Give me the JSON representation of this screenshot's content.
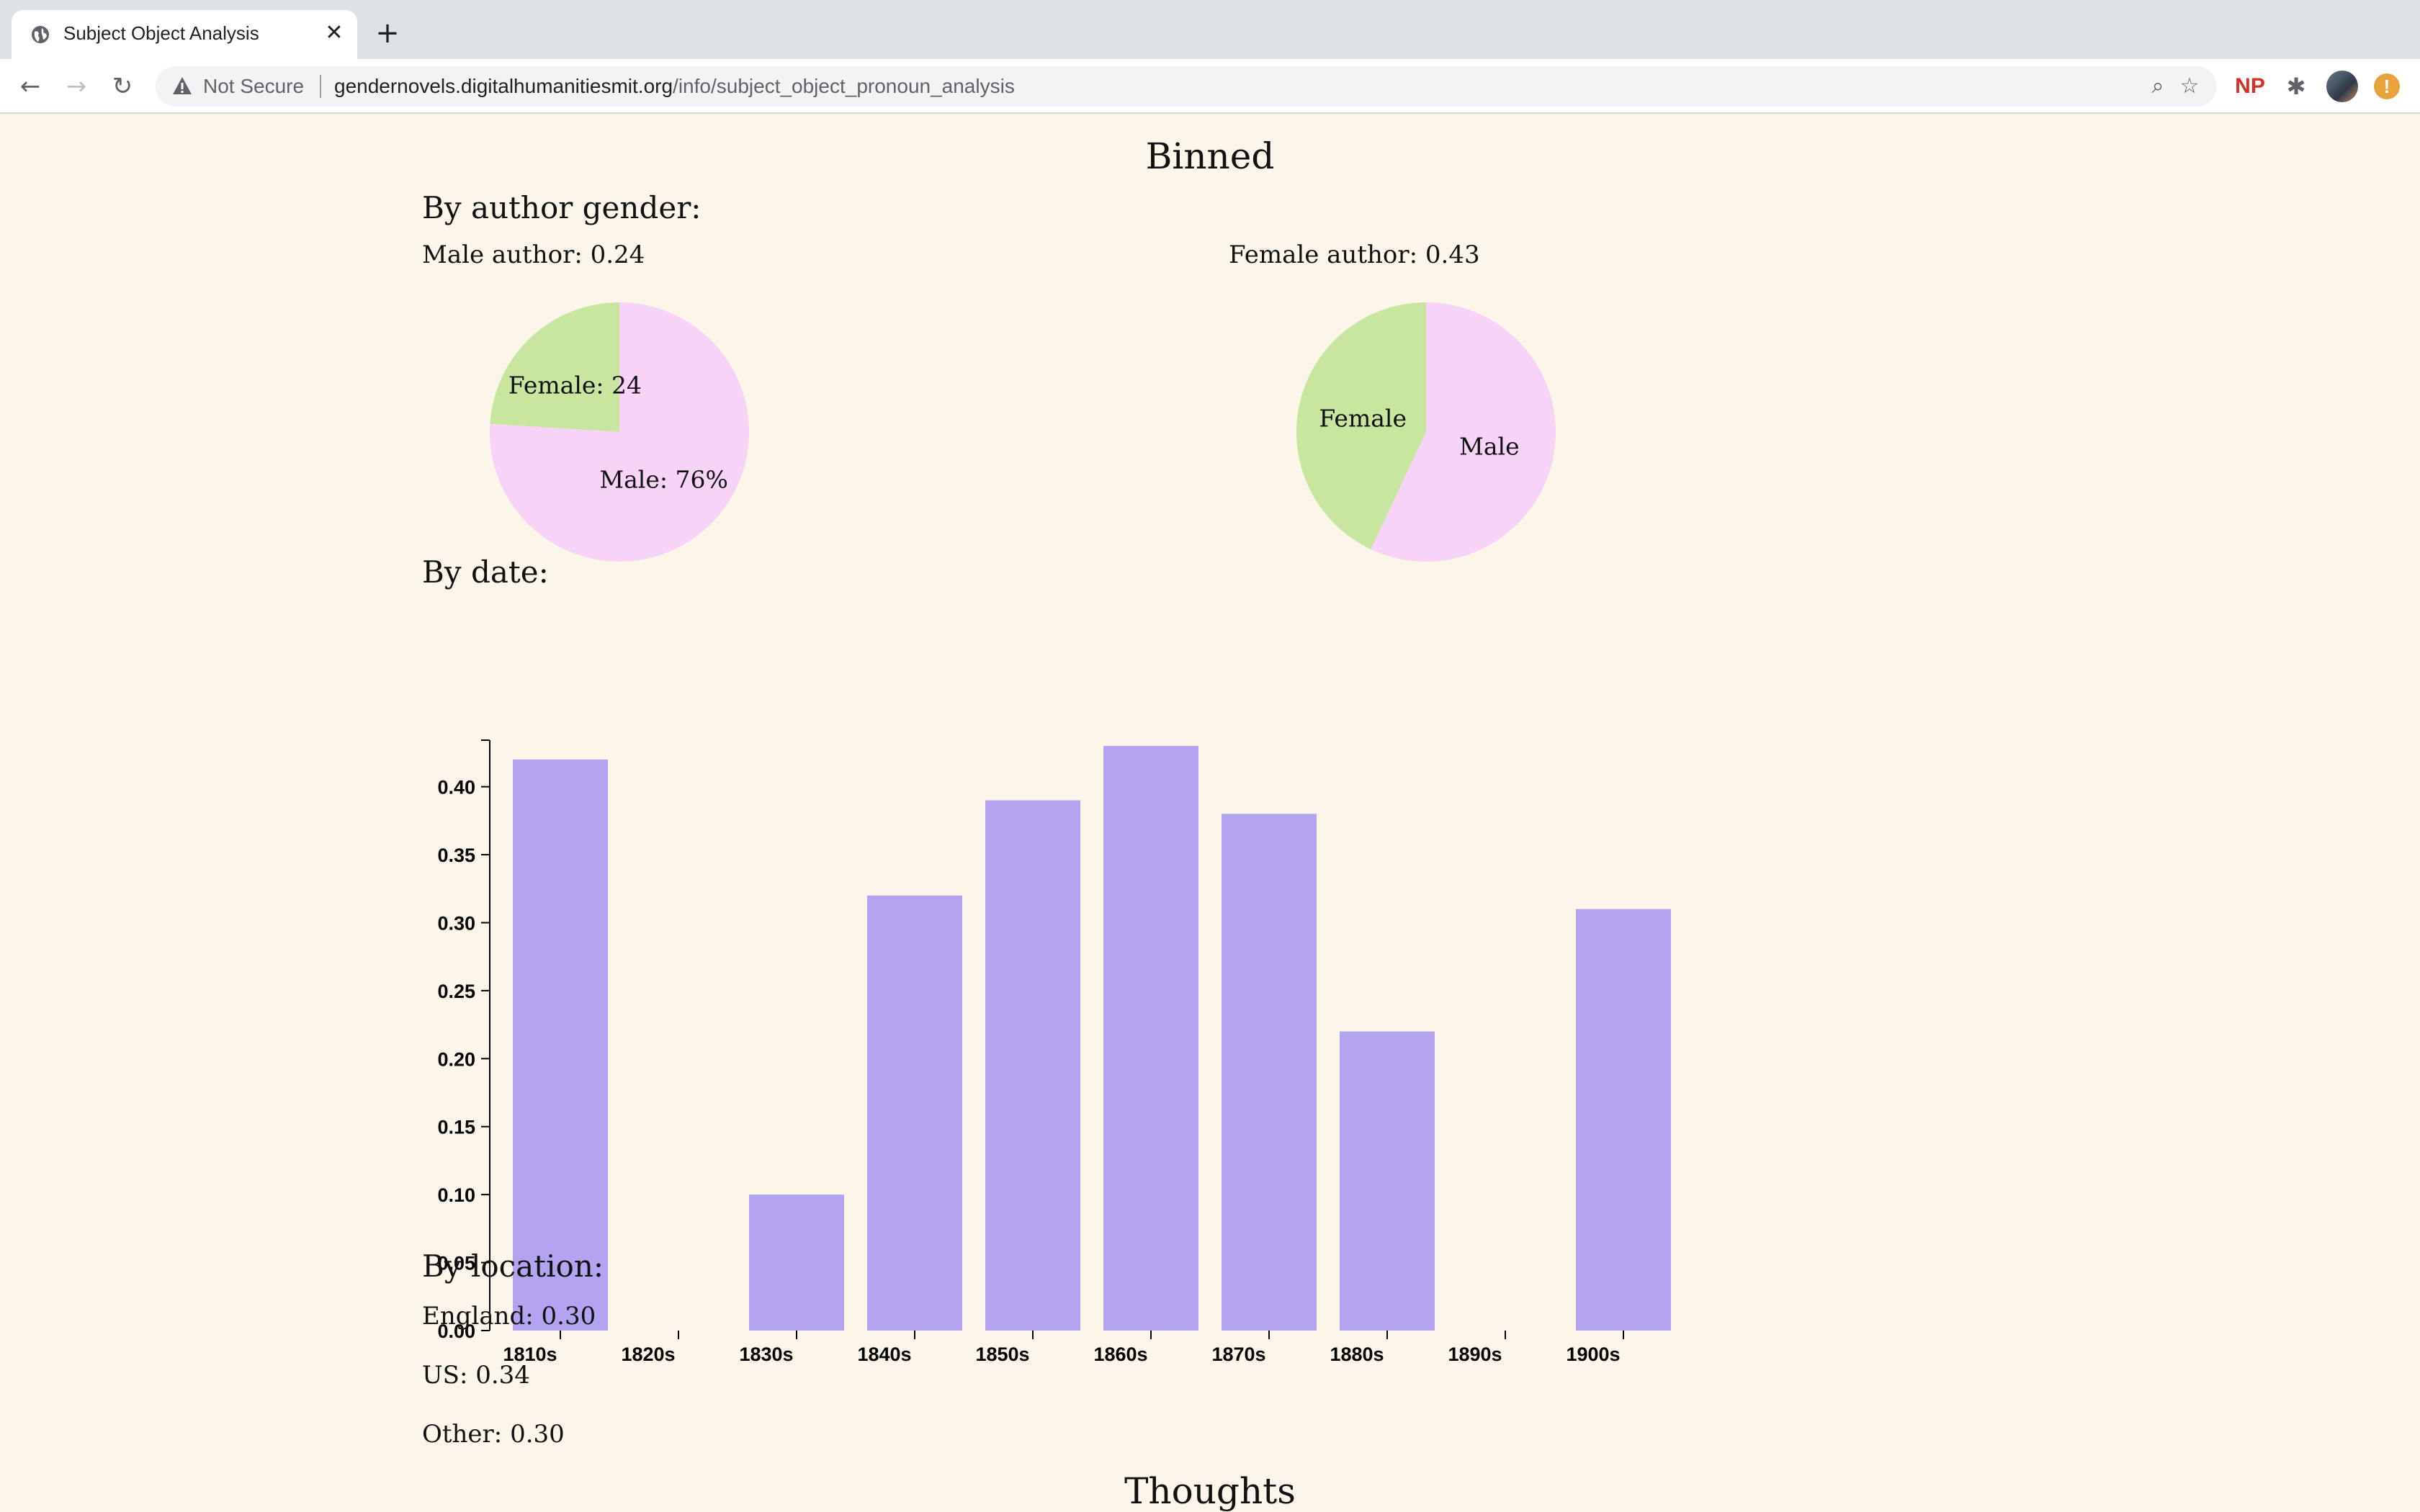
{
  "browser": {
    "tab_title": "Subject Object Analysis",
    "tab_close_glyph": "✕",
    "new_tab_glyph": "+",
    "security_label": "Not Secure",
    "url_host": "gendernovels.digitalhumanitiesmit.org",
    "url_path": "/info/subject_object_pronoun_analysis",
    "extension_np": "NP",
    "update_badge": "!"
  },
  "page": {
    "binned_heading": "Binned",
    "by_author_gender_heading": "By author gender:",
    "male_author_label": "Male author: 0.24",
    "female_author_label": "Female author: 0.43",
    "by_date_heading": "By date:",
    "by_location_heading": "By location:",
    "locations": [
      "England: 0.30",
      "US: 0.34",
      "Other: 0.30"
    ],
    "thoughts_heading": "Thoughts"
  },
  "colors": {
    "female_slice": "#c8e6a0",
    "male_slice": "#f7d4f7",
    "bar": "#b3a3f0",
    "page_bg": "#fbf5ea"
  },
  "chart_data": [
    {
      "type": "pie",
      "title": "Male author: 0.24",
      "slices": [
        {
          "label": "Female: 24",
          "value": 24
        },
        {
          "label": "Male: 76%",
          "value": 76
        }
      ]
    },
    {
      "type": "pie",
      "title": "Female author: 0.43",
      "slices": [
        {
          "label": "Female",
          "value": 43
        },
        {
          "label": "Male",
          "value": 57
        }
      ]
    },
    {
      "type": "bar",
      "title": "By date:",
      "categories": [
        "1810s",
        "1820s",
        "1830s",
        "1840s",
        "1850s",
        "1860s",
        "1870s",
        "1880s",
        "1890s",
        "1900s"
      ],
      "values": [
        0.42,
        null,
        0.1,
        0.32,
        0.39,
        0.43,
        0.38,
        0.22,
        null,
        0.31
      ],
      "yticks": [
        "0.00",
        "0.05",
        "0.10",
        "0.15",
        "0.20",
        "0.25",
        "0.30",
        "0.35",
        "0.40"
      ],
      "ylim": [
        0,
        0.43
      ],
      "grid": false
    }
  ]
}
